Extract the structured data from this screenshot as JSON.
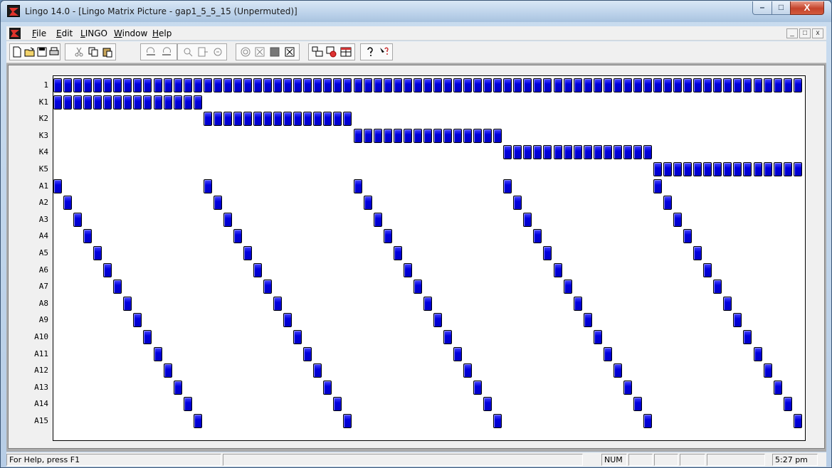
{
  "window": {
    "title": "Lingo 14.0 - [Lingo Matrix Picture - gap1_5_5_15 (Unpermuted)]",
    "min_glyph": "–",
    "max_glyph": "□",
    "close_glyph": "X"
  },
  "menubar": {
    "items": [
      {
        "label": "File",
        "accel": "F"
      },
      {
        "label": "Edit",
        "accel": "E"
      },
      {
        "label": "LINGO",
        "accel": "L"
      },
      {
        "label": "Window",
        "accel": "W"
      },
      {
        "label": "Help",
        "accel": "H"
      }
    ],
    "mdi_min": "_",
    "mdi_restore": "□",
    "mdi_close": "x"
  },
  "matrix": {
    "row_labels": [
      "1",
      "K1",
      "K2",
      "K3",
      "K4",
      "K5",
      "A1",
      "A2",
      "A3",
      "A4",
      "A5",
      "A6",
      "A7",
      "A8",
      "A9",
      "A10",
      "A11",
      "A12",
      "A13",
      "A14",
      "A15"
    ],
    "columns": 75,
    "color": "#0000e0"
  },
  "statusbar": {
    "help": "For Help, press F1",
    "num": "NUM",
    "time": "5:27 pm"
  }
}
